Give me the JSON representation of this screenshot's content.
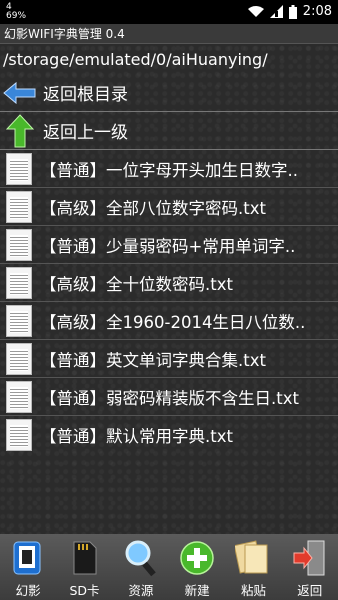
{
  "status_bar": {
    "indicator_top": "4",
    "indicator_bottom": "69%",
    "time": "2:08"
  },
  "app_title": "幻影WIFI字典管理 0.4",
  "current_path": "/storage/emulated/0/aiHuanying/",
  "nav": {
    "root_label": "返回根目录",
    "up_label": "返回上一级"
  },
  "files": [
    {
      "name": "【普通】一位字母开头加生日数字.."
    },
    {
      "name": "【高级】全部八位数字密码.txt"
    },
    {
      "name": "【普通】少量弱密码+常用单词字.."
    },
    {
      "name": "【高级】全十位数密码.txt"
    },
    {
      "name": "【高级】全1960-2014生日八位数.."
    },
    {
      "name": "【普通】英文单词字典合集.txt"
    },
    {
      "name": "【普通】弱密码精装版不含生日.txt"
    },
    {
      "name": "【普通】默认常用字典.txt"
    }
  ],
  "toolbar": [
    {
      "label": "幻影",
      "icon": "phone-icon"
    },
    {
      "label": "SD卡",
      "icon": "sd-card-icon"
    },
    {
      "label": "资源",
      "icon": "magnifier-icon"
    },
    {
      "label": "新建",
      "icon": "plus-icon"
    },
    {
      "label": "粘贴",
      "icon": "paste-icon"
    },
    {
      "label": "返回",
      "icon": "exit-door-icon"
    }
  ],
  "colors": {
    "accent_green": "#49b82b",
    "arrow_blue": "#3a86d8",
    "toolbar_bg": "#4a4a4a"
  }
}
